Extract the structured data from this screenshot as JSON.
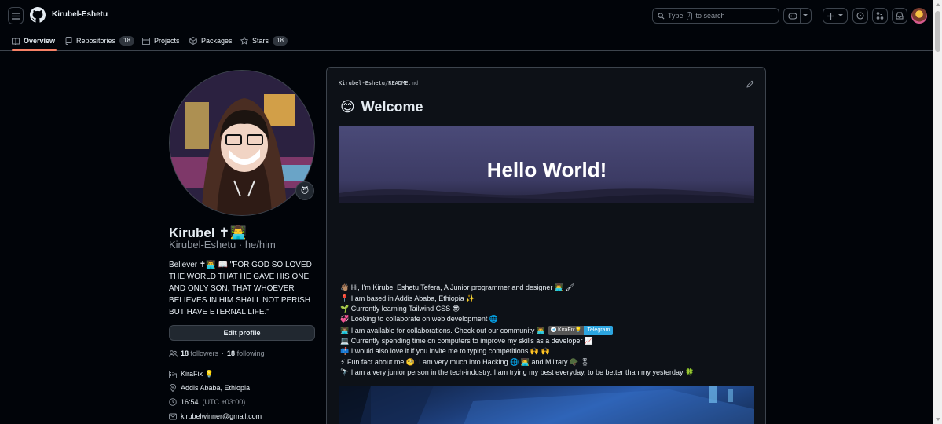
{
  "header": {
    "owner": "Kirubel-Eshetu",
    "search_prefix": "Type",
    "search_key": "/",
    "search_suffix": "to search"
  },
  "tabs": [
    {
      "label": "Overview",
      "count": null
    },
    {
      "label": "Repositories",
      "count": "18"
    },
    {
      "label": "Projects",
      "count": null
    },
    {
      "label": "Packages",
      "count": null
    },
    {
      "label": "Stars",
      "count": "18"
    }
  ],
  "profile": {
    "badge_emoji": "😈",
    "name": "Kirubel ✝👨‍💻",
    "login": "Kirubel-Eshetu · he/him",
    "bio": "Believer ✝👨‍💻 📖 \"FOR GOD SO LOVED THE WORLD THAT HE GAVE HIS ONE AND ONLY SON, THAT WHOEVER BELIEVES IN HIM SHALL NOT PERISH BUT HAVE ETERNAL LIFE.\"",
    "edit_label": "Edit profile",
    "followers": "18",
    "followers_label": "followers",
    "following": "18",
    "following_label": "following",
    "org": "KiraFix 💡",
    "location": "Addis Ababa, Ethiopia",
    "time": "16:54",
    "timezone": "(UTC +03:00)",
    "email": "kirubelwinner@gmail.com"
  },
  "readme": {
    "crumb_owner": "Kirubel-Eshetu",
    "crumb_sep": "/",
    "crumb_file": "README",
    "crumb_ext": ".md",
    "welcome_emoji": "😊",
    "welcome": "Welcome",
    "banner": "Hello World!",
    "lines": [
      "👋🏽 Hi, I'm Kirubel Eshetu Tefera, A Junior programmer and designer 👨‍💻 🖌",
      "📍 I am based in Addis Ababa, Ethiopia ✨",
      "🌱 Currently learning Tailwind CSS 😎",
      "💞️ Looking to collaborate on web development 🌐",
      "👨🏽‍💻 I am available for collaborations. Check out our community 👨‍💻",
      "💻 Currently spending time on computers to improve my skills as a developer 📈",
      "📫 I would also love it if you invite me to typing competitions 🙌 🙌",
      "⚡ Fun fact about me 🧐: I am very much into Hacking 🌐 👨‍💻 and Military 🪖 🎖",
      "🔭 I am a very junior person in the tech-industry. I am trying my best everyday, to be better than my yesterday 🍀"
    ],
    "tg_left": "KiraFix💡",
    "tg_right": "Telegram"
  }
}
